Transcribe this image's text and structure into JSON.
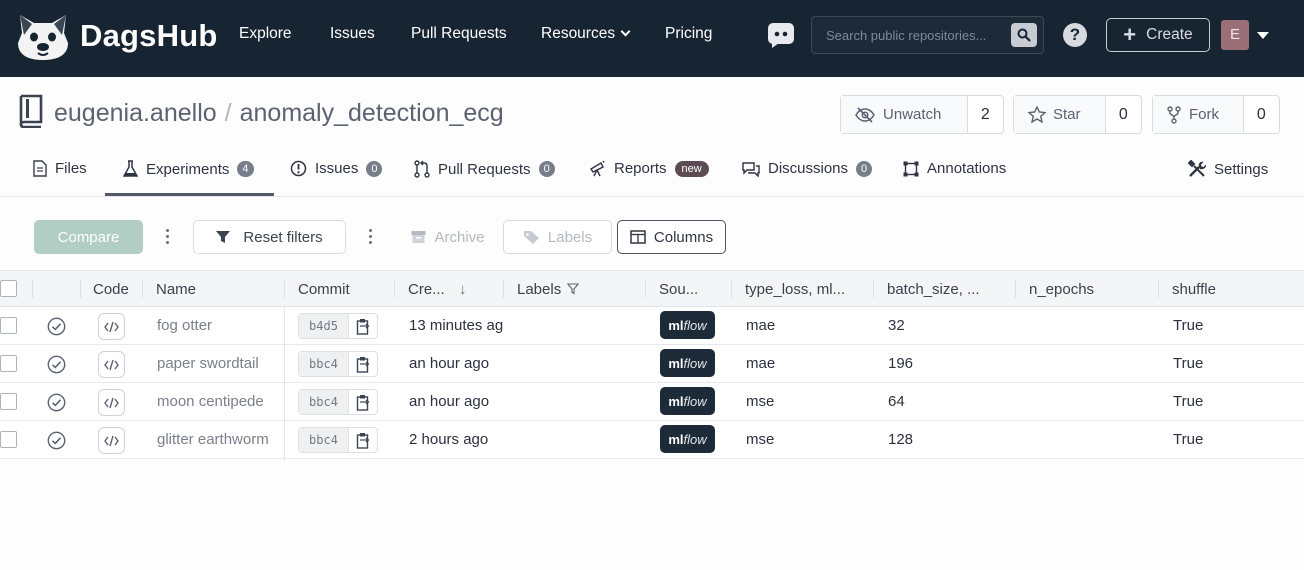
{
  "nav": {
    "brand": "DagsHub",
    "links": [
      "Explore",
      "Issues",
      "Pull Requests",
      "Resources",
      "Pricing"
    ],
    "search_placeholder": "Search public repositories...",
    "help_glyph": "?",
    "create_label": "Create",
    "user_initial": "E"
  },
  "repo": {
    "owner": "eugenia.anello",
    "separator": "/",
    "name": "anomaly_detection_ecg",
    "watch_label": "Unwatch",
    "watch_count": "2",
    "star_label": "Star",
    "star_count": "0",
    "fork_label": "Fork",
    "fork_count": "0"
  },
  "tabs": {
    "files": "Files",
    "experiments": "Experiments",
    "experiments_count": "4",
    "issues": "Issues",
    "issues_count": "0",
    "pulls": "Pull Requests",
    "pulls_count": "0",
    "reports": "Reports",
    "reports_badge": "new",
    "discussions": "Discussions",
    "discussions_count": "0",
    "annotations": "Annotations",
    "settings": "Settings"
  },
  "toolbar": {
    "compare": "Compare",
    "reset_filters": "Reset filters",
    "archive": "Archive",
    "labels": "Labels",
    "columns": "Columns"
  },
  "table": {
    "columns": [
      "Code",
      "Name",
      "Commit",
      "Cre...",
      "Labels",
      "Sou...",
      "type_loss, ml...",
      "batch_size, ...",
      "n_epochs",
      "shuffle"
    ],
    "sort_indicator": "↓",
    "source_ml": "ml",
    "source_flow": "flow",
    "rows": [
      {
        "name": "fog otter",
        "commit": "b4d5",
        "created": "13 minutes ag",
        "type_loss": "mae",
        "batch_size": "32",
        "n_epochs": "",
        "shuffle": "True"
      },
      {
        "name": "paper swordtail",
        "commit": "bbc4",
        "created": "an hour ago",
        "type_loss": "mae",
        "batch_size": "196",
        "n_epochs": "",
        "shuffle": "True"
      },
      {
        "name": "moon centipede",
        "commit": "bbc4",
        "created": "an hour ago",
        "type_loss": "mse",
        "batch_size": "64",
        "n_epochs": "",
        "shuffle": "True"
      },
      {
        "name": "glitter earthworm",
        "commit": "bbc4",
        "created": "2 hours ago",
        "type_loss": "mse",
        "batch_size": "128",
        "n_epochs": "",
        "shuffle": "True"
      }
    ]
  },
  "colors": {
    "nav_bg": "#172432",
    "compare_bg": "#b2cdc4",
    "mlflow_bg": "#1d2b39"
  }
}
